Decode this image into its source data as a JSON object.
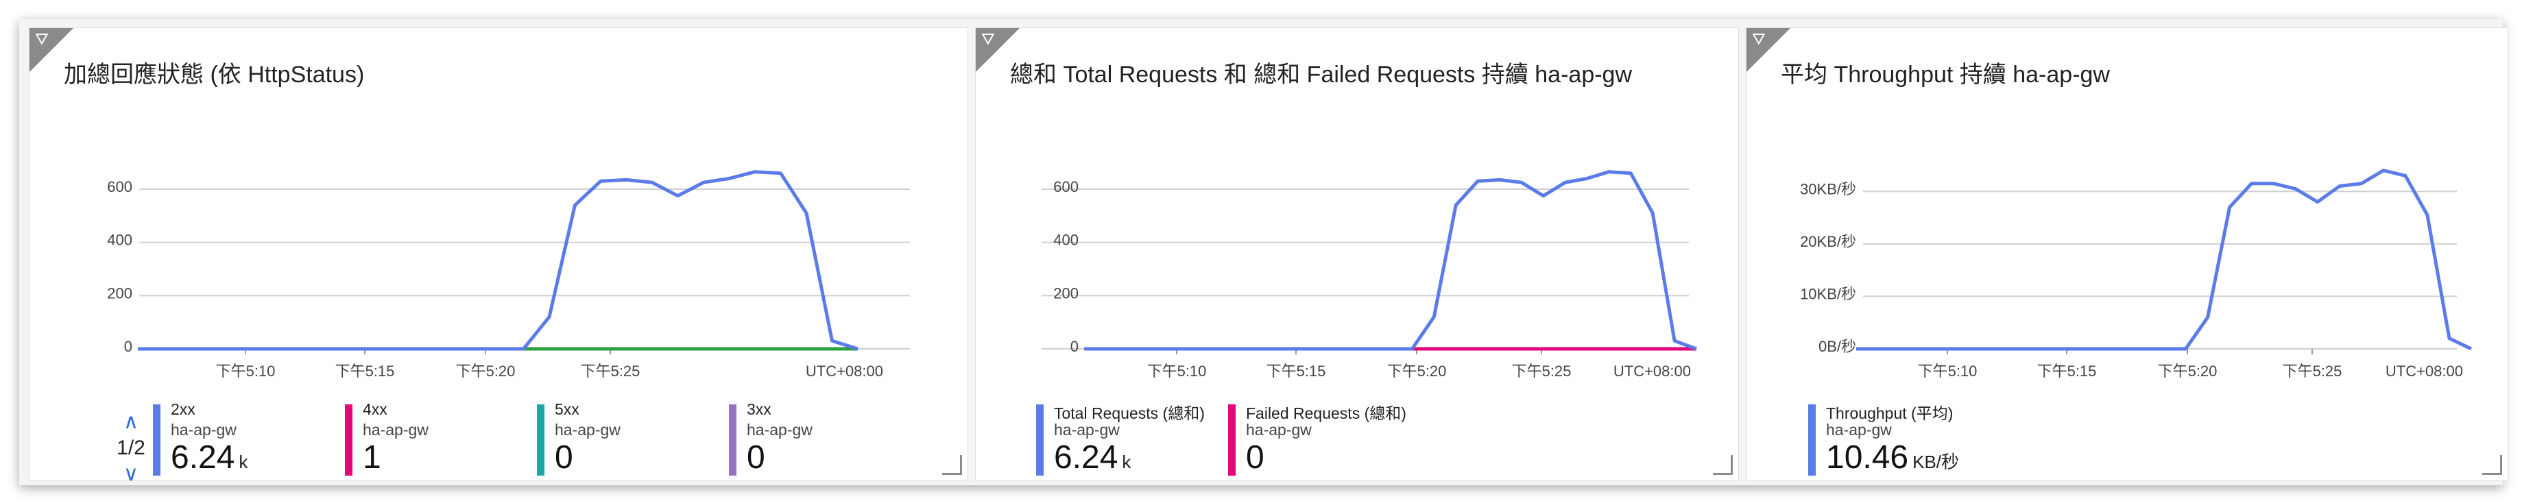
{
  "tiles": [
    {
      "title": "加總回應狀態 (依 HttpStatus)",
      "pager": {
        "up_icon": "chevron-up-icon",
        "down_icon": "chevron-down-icon",
        "page": "1/2"
      },
      "legend": [
        {
          "name": "2xx",
          "resource": "ha-ap-gw",
          "value": "6.24",
          "unit": "k",
          "color": "#5b7be8"
        },
        {
          "name": "4xx",
          "resource": "ha-ap-gw",
          "value": "1",
          "unit": "",
          "color": "#e3077a"
        },
        {
          "name": "5xx",
          "resource": "ha-ap-gw",
          "value": "0",
          "unit": "",
          "color": "#20a3a3"
        },
        {
          "name": "3xx",
          "resource": "ha-ap-gw",
          "value": "0",
          "unit": "",
          "color": "#9672c2"
        }
      ]
    },
    {
      "title": "總和 Total Requests 和 總和 Failed Requests 持續 ha-ap-gw",
      "legend": [
        {
          "name": "Total Requests (總和)",
          "resource": "ha-ap-gw",
          "value": "6.24",
          "unit": "k",
          "color": "#5b7be8"
        },
        {
          "name": "Failed Requests (總和)",
          "resource": "ha-ap-gw",
          "value": "0",
          "unit": "",
          "color": "#e3077a"
        }
      ]
    },
    {
      "title": "平均 Throughput 持續 ha-ap-gw",
      "legend": [
        {
          "name": "Throughput (平均)",
          "resource": "ha-ap-gw",
          "value": "10.46",
          "unit": "KB/秒",
          "color": "#5b7be8"
        }
      ]
    }
  ],
  "chart_data": [
    {
      "type": "line",
      "title": "加總回應狀態 (依 HttpStatus)",
      "x_ticks": [
        "下午5:10",
        "下午5:15",
        "下午5:20",
        "下午5:25"
      ],
      "timezone_label": "UTC+08:00",
      "y_ticks": [
        "0",
        "200",
        "400",
        "600"
      ],
      "ylim": [
        0,
        690
      ],
      "xlim": [
        5.0,
        33.0
      ],
      "grid": true,
      "x": [
        5,
        6,
        7,
        8,
        9,
        10,
        11,
        12,
        13,
        14,
        15,
        16,
        17,
        18,
        19,
        20,
        21,
        22,
        23,
        24,
        25,
        26,
        27,
        28,
        29,
        30,
        31,
        32,
        33
      ],
      "series": [
        {
          "name": "2xx",
          "color": "#5b7be8",
          "values": [
            0,
            0,
            0,
            0,
            0,
            0,
            0,
            0,
            0,
            0,
            0,
            0,
            0,
            0,
            0,
            0,
            120,
            540,
            630,
            635,
            625,
            575,
            625,
            640,
            665,
            660,
            510,
            30,
            0
          ]
        },
        {
          "name": "4xx",
          "color": "#2ea043",
          "values": [
            0,
            0,
            0,
            0,
            0,
            0,
            0,
            0,
            0,
            0,
            0,
            0,
            0,
            0,
            0,
            0,
            0,
            0,
            0,
            0,
            0,
            0,
            0,
            0,
            0,
            0,
            0,
            0,
            0
          ]
        }
      ]
    },
    {
      "type": "line",
      "title": "總和 Total Requests 和 總和 Failed Requests 持續 ha-ap-gw",
      "x_ticks": [
        "下午5:10",
        "下午5:15",
        "下午5:20",
        "下午5:25"
      ],
      "timezone_label": "UTC+08:00",
      "y_ticks": [
        "0",
        "200",
        "400",
        "600"
      ],
      "ylim": [
        0,
        690
      ],
      "xlim": [
        5.0,
        33.0
      ],
      "grid": true,
      "x": [
        5,
        6,
        7,
        8,
        9,
        10,
        11,
        12,
        13,
        14,
        15,
        16,
        17,
        18,
        19,
        20,
        21,
        22,
        23,
        24,
        25,
        26,
        27,
        28,
        29,
        30,
        31,
        32,
        33
      ],
      "series": [
        {
          "name": "Total Requests (總和)",
          "color": "#5b7be8",
          "values": [
            0,
            0,
            0,
            0,
            0,
            0,
            0,
            0,
            0,
            0,
            0,
            0,
            0,
            0,
            0,
            0,
            120,
            540,
            630,
            635,
            625,
            575,
            625,
            640,
            665,
            660,
            510,
            30,
            0
          ]
        },
        {
          "name": "Failed Requests (總和)",
          "color": "#e3077a",
          "values": [
            0,
            0,
            0,
            0,
            0,
            0,
            0,
            0,
            0,
            0,
            0,
            0,
            0,
            0,
            0,
            0,
            0,
            0,
            0,
            0,
            0,
            0,
            0,
            0,
            0,
            0,
            0,
            0,
            0
          ]
        }
      ]
    },
    {
      "type": "line",
      "title": "平均 Throughput 持續 ha-ap-gw",
      "x_ticks": [
        "下午5:10",
        "下午5:15",
        "下午5:20",
        "下午5:25"
      ],
      "timezone_label": "UTC+08:00",
      "y_ticks": [
        "0B/秒",
        "10KB/秒",
        "20KB/秒",
        "30KB/秒"
      ],
      "ylim": [
        0,
        35
      ],
      "xlim": [
        5.0,
        33.0
      ],
      "grid": true,
      "x": [
        5,
        6,
        7,
        8,
        9,
        10,
        11,
        12,
        13,
        14,
        15,
        16,
        17,
        18,
        19,
        20,
        21,
        22,
        23,
        24,
        25,
        26,
        27,
        28,
        29,
        30,
        31,
        32,
        33
      ],
      "series": [
        {
          "name": "Throughput (平均)",
          "color": "#5b7be8",
          "values": [
            0,
            0,
            0,
            0,
            0,
            0,
            0,
            0,
            0,
            0,
            0,
            0,
            0,
            0,
            0,
            0,
            6,
            27,
            31.5,
            31.5,
            30.5,
            28,
            31,
            31.5,
            34,
            33,
            25.5,
            2,
            0
          ]
        }
      ]
    }
  ]
}
